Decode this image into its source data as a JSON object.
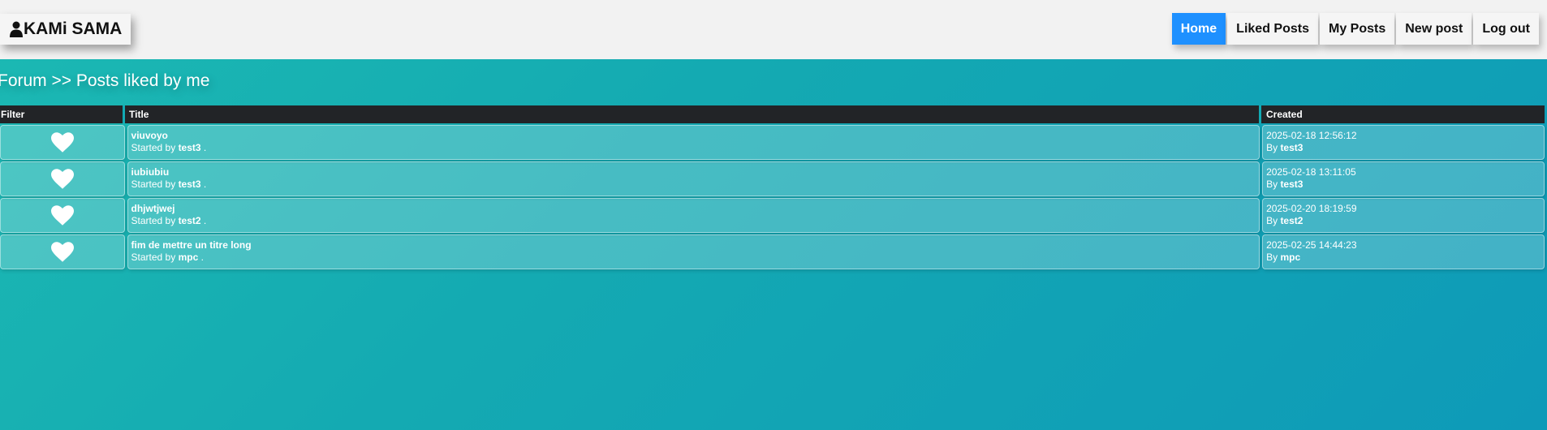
{
  "header": {
    "brand": "KAMi SAMA",
    "brand_icon": "user-icon",
    "nav": [
      {
        "label": "Home",
        "active": true
      },
      {
        "label": "Liked Posts",
        "active": false
      },
      {
        "label": "My Posts",
        "active": false
      },
      {
        "label": "New post",
        "active": false
      },
      {
        "label": "Log out",
        "active": false
      }
    ]
  },
  "breadcrumb": "Forum >> Posts liked by me",
  "table": {
    "headers": {
      "filter": "Filter",
      "title": "Title",
      "created": "Created"
    },
    "started_by_prefix": "Started by",
    "by_prefix": "By",
    "suffix": ".",
    "rows": [
      {
        "title": "viuvoyo",
        "author": "test3",
        "created": "2025-02-18 12:56:12"
      },
      {
        "title": "iubiubiu",
        "author": "test3",
        "created": "2025-02-18 13:11:05"
      },
      {
        "title": "dhjwtjwej",
        "author": "test2",
        "created": "2025-02-20 18:19:59"
      },
      {
        "title": "fim de mettre un titre long",
        "author": "mpc",
        "created": "2025-02-25 14:44:23"
      }
    ]
  },
  "colors": {
    "accent": "#1e90ff",
    "header_bg": "#222427",
    "topbar_bg": "#f2f2f2"
  }
}
